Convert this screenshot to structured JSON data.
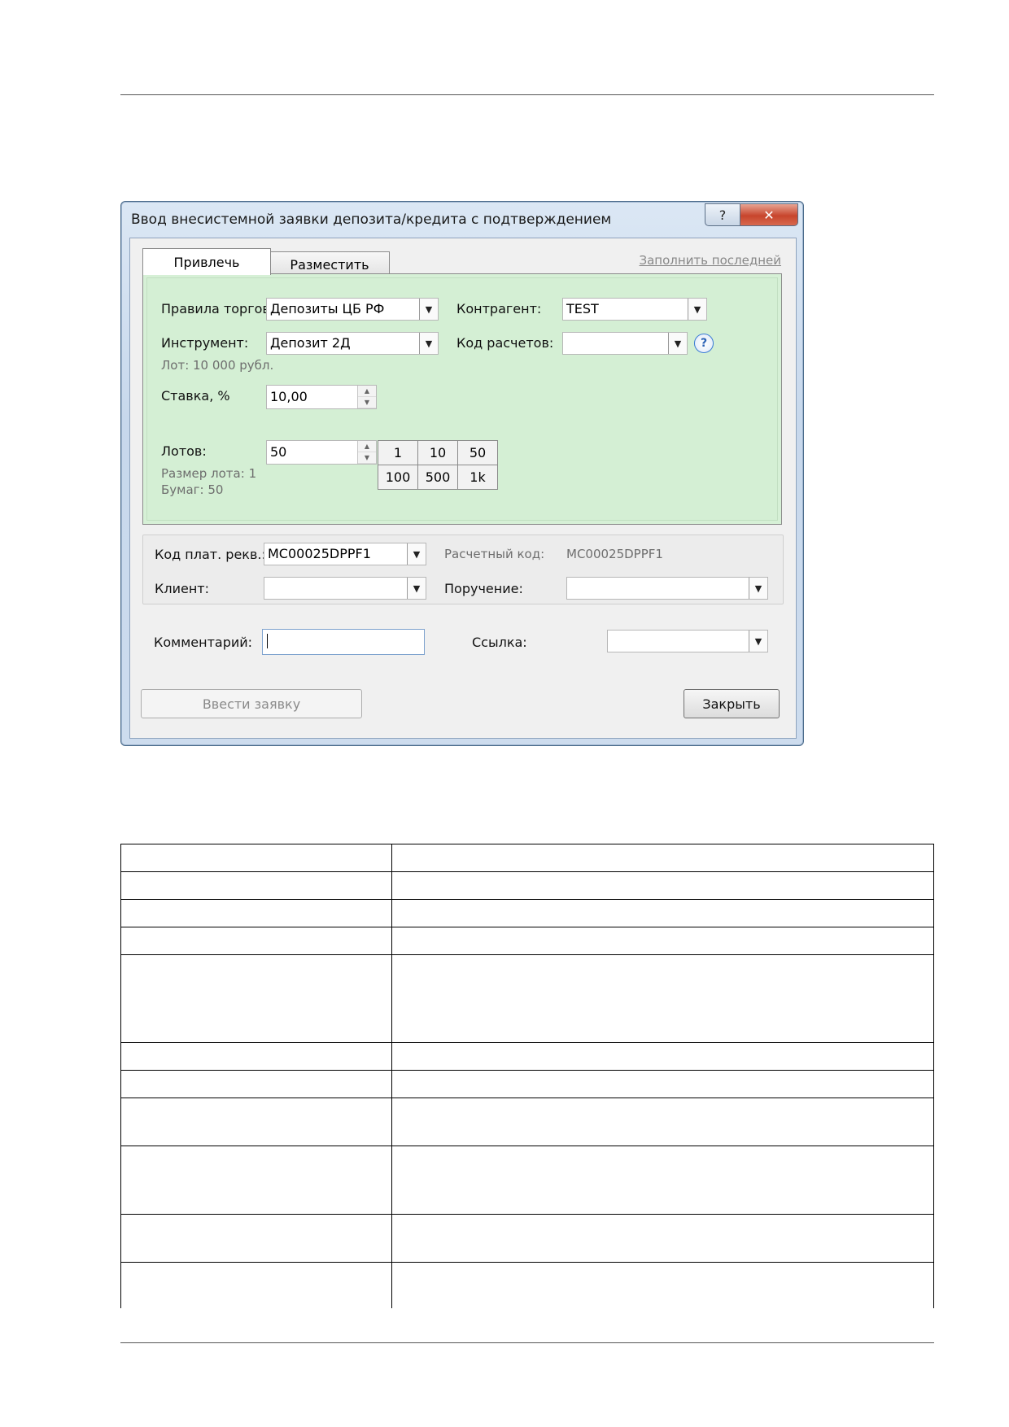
{
  "dialog": {
    "title": "Ввод внесистемной заявки депозита/кредита с подтверждением",
    "help_label": "?",
    "close_label": "✕",
    "tabs": [
      {
        "label": "Привлечь",
        "active": true
      },
      {
        "label": "Разместить",
        "active": false
      }
    ],
    "fill_last_link": "Заполнить последней",
    "trade_rules": {
      "label": "Правила торгов:",
      "value": "Депозиты ЦБ РФ"
    },
    "counterparty": {
      "label": "Контрагент:",
      "value": "TEST"
    },
    "instrument": {
      "label": "Инструмент:",
      "value": "Депозит 2Д"
    },
    "settlement_code_field": {
      "label": "Код расчетов:",
      "value": ""
    },
    "lot_info": "Лот: 10 000 рубл.",
    "rate": {
      "label": "Ставка, %",
      "value": "10,00"
    },
    "lots": {
      "label": "Лотов:",
      "value": "50"
    },
    "lot_size_info": "Размер лота: 1",
    "papers_info": "Бумаг: 50",
    "quick_lots": [
      [
        "1",
        "10",
        "50"
      ],
      [
        "100",
        "500",
        "1k"
      ]
    ],
    "payment_details": {
      "label": "Код плат. рекв.:",
      "value": "MC00025DPPF1"
    },
    "calc_code": {
      "label": "Расчетный код:",
      "value": "MC00025DPPF1"
    },
    "client": {
      "label": "Клиент:",
      "value": ""
    },
    "order": {
      "label": "Поручение:",
      "value": ""
    },
    "comment": {
      "label": "Комментарий:",
      "value": ""
    },
    "link": {
      "label": "Ссылка:",
      "value": ""
    },
    "submit_label": "Ввести заявку",
    "close_button_label": "Закрыть",
    "arrow_glyph": "▼",
    "spin_up_glyph": "▲",
    "spin_down_glyph": "▼"
  },
  "colors": {
    "green_panel": "#d4efd4",
    "title_bar": "#c7d8ec",
    "close_red": "#c7452c"
  }
}
